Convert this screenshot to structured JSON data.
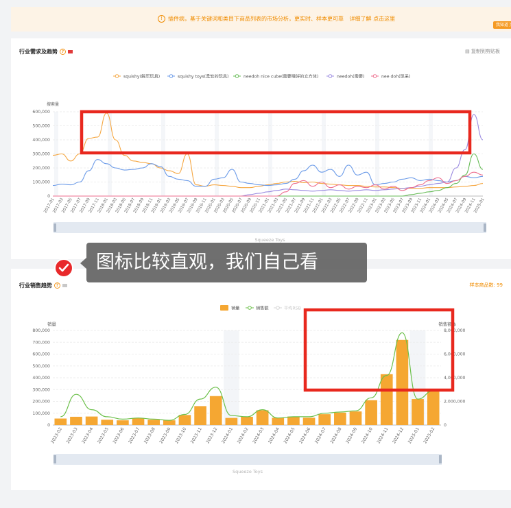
{
  "banner": {
    "icon": "info-circle-icon",
    "message": "插件病，基于关键词和类目下商品列表的市场分析，更实时、样本更可靠",
    "link": "详细了解 点击这里",
    "button": "我知道了"
  },
  "panel1": {
    "title": "行业需求及趋势",
    "copy": "复制到剪贴板",
    "scrollbar_label": "Squeeze Toys"
  },
  "panel2": {
    "title": "行业销售趋势",
    "samples": "样本商品数: 99",
    "scrollbar_label": "Squeeze Toys"
  },
  "toast": {
    "text": "图标比较直观，我们自己看",
    "icon": "check-circle-icon"
  },
  "colors": {
    "accent": "#f59a23",
    "annotation": "#e8281e"
  },
  "chart_data": [
    {
      "type": "line",
      "ylabel": "搜索量",
      "ylim": [
        0,
        600000
      ],
      "yticks": [
        "0",
        "100,000",
        "200,000",
        "300,000",
        "400,000",
        "500,000",
        "600,000"
      ],
      "xticks": [
        "2017-01",
        "2017-03",
        "2017-05",
        "2017-07",
        "2017-09",
        "2017-11",
        "2018-01",
        "2018-03",
        "2018-05",
        "2018-07",
        "2018-09",
        "2018-11",
        "2019-01",
        "2019-03",
        "2019-05",
        "2019-07",
        "2019-09",
        "2019-11",
        "2020-01",
        "2020-03",
        "2020-05",
        "2020-07",
        "2020-09",
        "2020-11",
        "2021-01",
        "2021-03",
        "2021-05",
        "2021-07",
        "2021-09",
        "2021-11",
        "2022-01",
        "2022-03",
        "2022-05",
        "2022-07",
        "2022-09",
        "2022-11",
        "2023-01",
        "2023-03",
        "2023-05",
        "2023-07",
        "2023-09",
        "2023-11",
        "2024-01",
        "2024-03",
        "2024-05",
        "2024-07",
        "2024-09",
        "2024-11",
        "2025-01"
      ],
      "legend_position": "top-center",
      "grid": true,
      "series": [
        {
          "name": "squishy(解压玩具)",
          "color": "#f5a742",
          "values": [
            290000,
            300000,
            250000,
            300000,
            410000,
            420000,
            590000,
            400000,
            290000,
            250000,
            240000,
            230000,
            200000,
            180000,
            160000,
            300000,
            80000,
            70000,
            80000,
            75000,
            70000,
            60000,
            60000,
            70000,
            80000,
            90000,
            100000,
            105000,
            95000,
            100000,
            90000,
            85000,
            80000,
            75000,
            75000,
            70000,
            65000,
            65000,
            60000,
            55000,
            55000,
            55000,
            60000,
            60000,
            60000,
            65000,
            70000,
            75000,
            90000
          ]
        },
        {
          "name": "squishy toys(柔软的玩具)",
          "color": "#6a9ae8",
          "values": [
            75000,
            85000,
            80000,
            100000,
            180000,
            260000,
            230000,
            200000,
            185000,
            190000,
            200000,
            230000,
            210000,
            140000,
            120000,
            110000,
            70000,
            70000,
            120000,
            130000,
            190000,
            100000,
            90000,
            80000,
            75000,
            80000,
            90000,
            120000,
            180000,
            220000,
            170000,
            190000,
            140000,
            220000,
            150000,
            170000,
            80000,
            90000,
            100000,
            120000,
            130000,
            110000,
            120000,
            110000,
            100000,
            110000,
            140000,
            130000,
            140000
          ]
        },
        {
          "name": "needoh nice cube(需要哦好的立方体)",
          "color": "#66bb55",
          "values": [
            0,
            0,
            0,
            0,
            0,
            0,
            0,
            0,
            0,
            0,
            0,
            0,
            0,
            0,
            0,
            0,
            0,
            0,
            0,
            0,
            0,
            0,
            0,
            0,
            0,
            0,
            0,
            0,
            0,
            0,
            0,
            0,
            0,
            0,
            0,
            0,
            0,
            0,
            0,
            0,
            10000,
            20000,
            30000,
            40000,
            60000,
            90000,
            150000,
            300000,
            190000
          ]
        },
        {
          "name": "needoh(需要)",
          "color": "#9a8ae0",
          "values": [
            0,
            0,
            0,
            0,
            0,
            0,
            0,
            0,
            0,
            0,
            0,
            0,
            0,
            0,
            0,
            0,
            0,
            0,
            0,
            0,
            0,
            0,
            10000,
            20000,
            30000,
            40000,
            50000,
            45000,
            40000,
            35000,
            40000,
            45000,
            40000,
            35000,
            40000,
            45000,
            40000,
            45000,
            50000,
            55000,
            60000,
            70000,
            80000,
            90000,
            100000,
            200000,
            330000,
            580000,
            400000
          ]
        },
        {
          "name": "nee doh(现采)",
          "color": "#ee6e8e",
          "values": [
            0,
            0,
            0,
            0,
            0,
            0,
            0,
            0,
            0,
            0,
            0,
            0,
            0,
            0,
            0,
            0,
            0,
            0,
            0,
            0,
            0,
            0,
            0,
            0,
            0,
            0,
            30000,
            90000,
            110000,
            70000,
            100000,
            60000,
            80000,
            50000,
            70000,
            60000,
            80000,
            50000,
            70000,
            40000,
            60000,
            80000,
            110000,
            130000,
            90000,
            110000,
            140000,
            170000,
            150000
          ]
        }
      ]
    },
    {
      "type": "bar",
      "categories": [
        "2023-02",
        "2023-03",
        "2023-04",
        "2023-05",
        "2023-06",
        "2023-07",
        "2023-08",
        "2023-09",
        "2023-10",
        "2023-11",
        "2023-12",
        "2024-01",
        "2024-02",
        "2024-03",
        "2024-04",
        "2024-05",
        "2024-06",
        "2024-07",
        "2024-08",
        "2024-09",
        "2024-10",
        "2024-11",
        "2024-12",
        "2025-01",
        "2025-02"
      ],
      "ylabel": "销量",
      "ylabel_right": "销售额 $",
      "ylim": [
        0,
        800000
      ],
      "ylim_right": [
        0,
        8000000
      ],
      "yticks_left": [
        "0",
        "100,000",
        "200,000",
        "300,000",
        "400,000",
        "500,000",
        "600,000",
        "700,000",
        "800,000"
      ],
      "yticks_right": [
        "0",
        "2,000,000",
        "4,000,000",
        "6,000,000",
        "8,000,000"
      ],
      "legend": [
        "销量",
        "销售额",
        "平均RSB"
      ],
      "legend_position": "top-center",
      "grid": true,
      "series": [
        {
          "name": "销量",
          "color": "#f5a732",
          "values": [
            55000,
            70000,
            72000,
            45000,
            40000,
            60000,
            45000,
            40000,
            85000,
            160000,
            245000,
            60000,
            70000,
            125000,
            62000,
            72000,
            62000,
            92000,
            105000,
            115000,
            210000,
            430000,
            720000,
            220000,
            290000
          ]
        },
        {
          "name": "销售额",
          "color": "#6cc04a",
          "values": [
            700000,
            2600000,
            1300000,
            700000,
            500000,
            600000,
            500000,
            400000,
            900000,
            2200000,
            3200000,
            800000,
            700000,
            1300000,
            600000,
            700000,
            700000,
            1000000,
            1100000,
            1200000,
            2300000,
            4200000,
            7800000,
            2200000,
            2900000
          ]
        }
      ]
    }
  ]
}
